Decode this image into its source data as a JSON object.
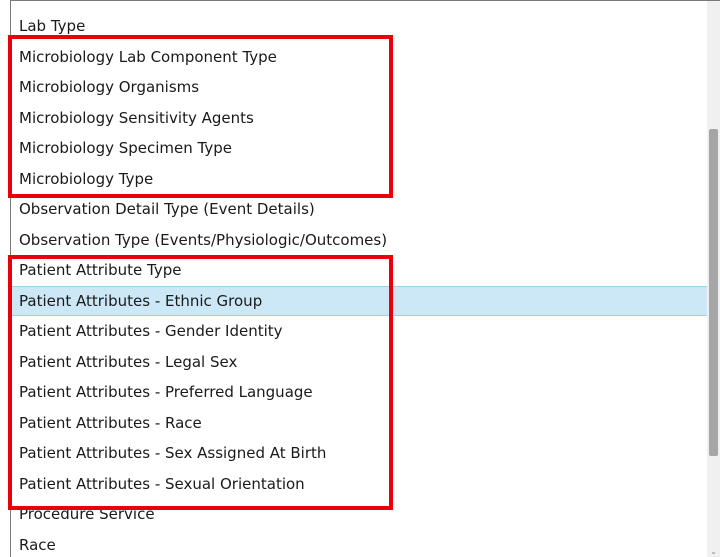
{
  "listbox": {
    "items": [
      {
        "label": "Lab Type",
        "selected": false
      },
      {
        "label": "Microbiology Lab Component Type",
        "selected": false
      },
      {
        "label": "Microbiology Organisms",
        "selected": false
      },
      {
        "label": "Microbiology Sensitivity Agents",
        "selected": false
      },
      {
        "label": "Microbiology Specimen Type",
        "selected": false
      },
      {
        "label": "Microbiology Type",
        "selected": false
      },
      {
        "label": "Observation Detail Type (Event Details)",
        "selected": false
      },
      {
        "label": "Observation Type (Events/Physiologic/Outcomes)",
        "selected": false
      },
      {
        "label": "Patient Attribute Type",
        "selected": false
      },
      {
        "label": "Patient Attributes - Ethnic Group",
        "selected": true
      },
      {
        "label": "Patient Attributes - Gender Identity",
        "selected": false
      },
      {
        "label": "Patient Attributes - Legal Sex",
        "selected": false
      },
      {
        "label": "Patient Attributes - Preferred Language",
        "selected": false
      },
      {
        "label": "Patient Attributes - Race",
        "selected": false
      },
      {
        "label": "Patient Attributes - Sex Assigned At Birth",
        "selected": false
      },
      {
        "label": "Patient Attributes - Sexual Orientation",
        "selected": false
      },
      {
        "label": "Procedure Service",
        "selected": false
      },
      {
        "label": "Race",
        "selected": false
      }
    ]
  },
  "scrollbar": {
    "down_arrow_icon": "chevron-down-icon"
  },
  "annotations": {
    "highlight_color": "#e8000b"
  },
  "colors": {
    "selection_background": "#cce8f7",
    "selection_border": "#99d1ef"
  }
}
